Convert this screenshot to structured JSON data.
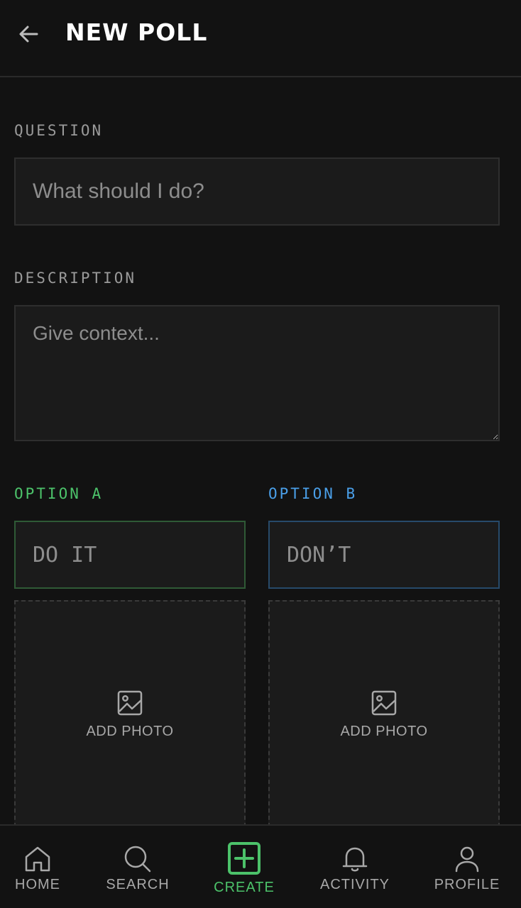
{
  "header": {
    "title": "NEW POLL",
    "back_icon": "arrow-left-icon"
  },
  "question": {
    "label": "QUESTION",
    "placeholder": "What should I do?",
    "value": ""
  },
  "description": {
    "label": "DESCRIPTION",
    "placeholder": "Give context...",
    "value": ""
  },
  "option_a": {
    "label": "OPTION A",
    "placeholder": "DO IT",
    "color": "#4cc26a",
    "photo_label": "ADD PHOTO",
    "photo_icon": "image-icon"
  },
  "option_b": {
    "label": "OPTION B",
    "placeholder": "DON’T",
    "color": "#4a9fe8",
    "photo_label": "ADD PHOTO",
    "photo_icon": "image-icon"
  },
  "nav": {
    "home": {
      "label": "HOME",
      "icon": "home-icon"
    },
    "search": {
      "label": "SEARCH",
      "icon": "search-icon"
    },
    "create": {
      "label": "CREATE",
      "icon": "plus-square-icon",
      "active": true,
      "color": "#4cc26a"
    },
    "activity": {
      "label": "ACTIVITY",
      "icon": "bell-icon"
    },
    "profile": {
      "label": "PROFILE",
      "icon": "user-icon"
    }
  },
  "colors": {
    "background": "#121212",
    "surface": "#1b1b1b",
    "accent_a": "#4cc26a",
    "accent_b": "#4a9fe8"
  }
}
